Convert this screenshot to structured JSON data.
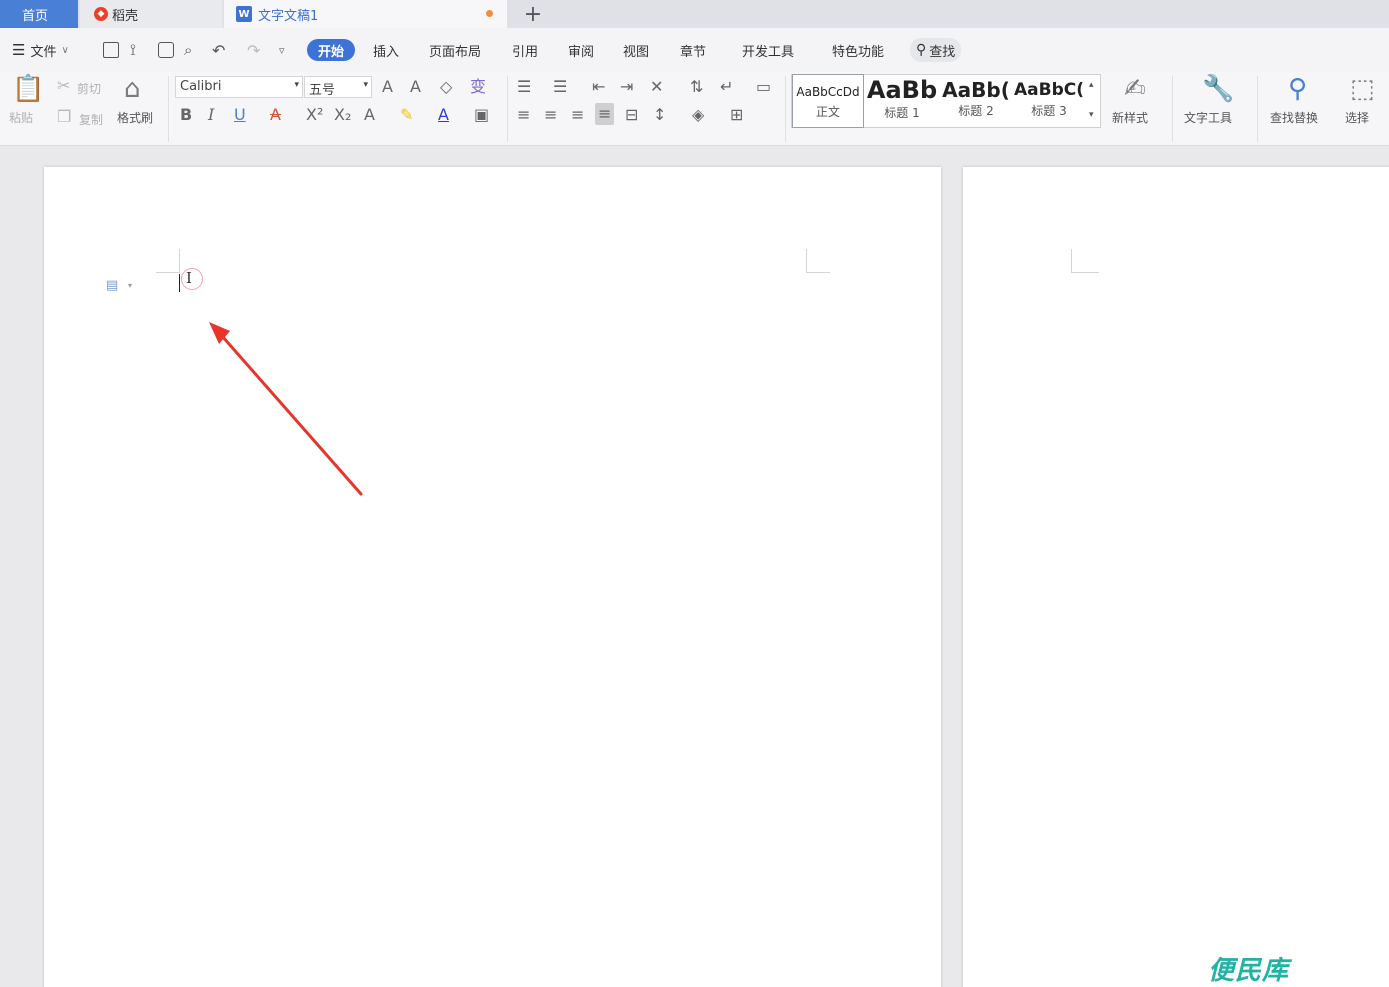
{
  "tabs": {
    "home": "首页",
    "docer": "稻壳",
    "document": "文字文稿1",
    "add": "+"
  },
  "menu": {
    "file": "文件",
    "items": [
      "开始",
      "插入",
      "页面布局",
      "引用",
      "审阅",
      "视图",
      "章节",
      "开发工具",
      "特色功能"
    ],
    "search": "查找"
  },
  "ribbon": {
    "paste": "粘贴",
    "cut": "剪切",
    "copy": "复制",
    "format_painter": "格式刷",
    "font_name": "Calibri",
    "font_size": "五号",
    "styles": [
      {
        "preview": "AaBbCcDd",
        "label": "正文"
      },
      {
        "preview": "AaBb",
        "label": "标题 1"
      },
      {
        "preview": "AaBb(",
        "label": "标题 2"
      },
      {
        "preview": "AaBbC(",
        "label": "标题 3"
      }
    ],
    "new_style": "新样式",
    "text_tools": "文字工具",
    "find_replace": "查找替换",
    "select": "选择"
  },
  "watermark": "便民库",
  "colors": {
    "accent": "#3d72d6",
    "arrow": "#e8342b",
    "watermark": "#1fb3a3"
  }
}
